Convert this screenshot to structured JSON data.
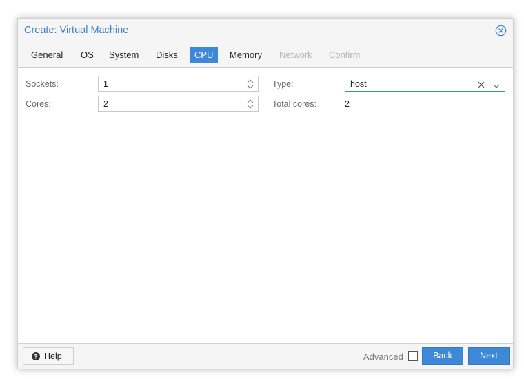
{
  "dialog": {
    "title": "Create: Virtual Machine",
    "close_icon": "close-circle-icon"
  },
  "tabs": [
    {
      "label": "General",
      "state": "normal"
    },
    {
      "label": "OS",
      "state": "normal"
    },
    {
      "label": "System",
      "state": "normal"
    },
    {
      "label": "Disks",
      "state": "normal"
    },
    {
      "label": "CPU",
      "state": "active"
    },
    {
      "label": "Memory",
      "state": "normal"
    },
    {
      "label": "Network",
      "state": "disabled"
    },
    {
      "label": "Confirm",
      "state": "disabled"
    }
  ],
  "cpu": {
    "sockets_label": "Sockets:",
    "sockets_value": "1",
    "cores_label": "Cores:",
    "cores_value": "2",
    "type_label": "Type:",
    "type_value": "host",
    "total_cores_label": "Total cores:",
    "total_cores_value": "2"
  },
  "footer": {
    "help_label": "Help",
    "help_icon": "question-circle-icon",
    "advanced_label": "Advanced",
    "advanced_checked": false,
    "back_label": "Back",
    "next_label": "Next"
  },
  "colors": {
    "accent": "#3e88d8",
    "title": "#3d7fc2",
    "disabled_text": "#b3b3b3"
  }
}
